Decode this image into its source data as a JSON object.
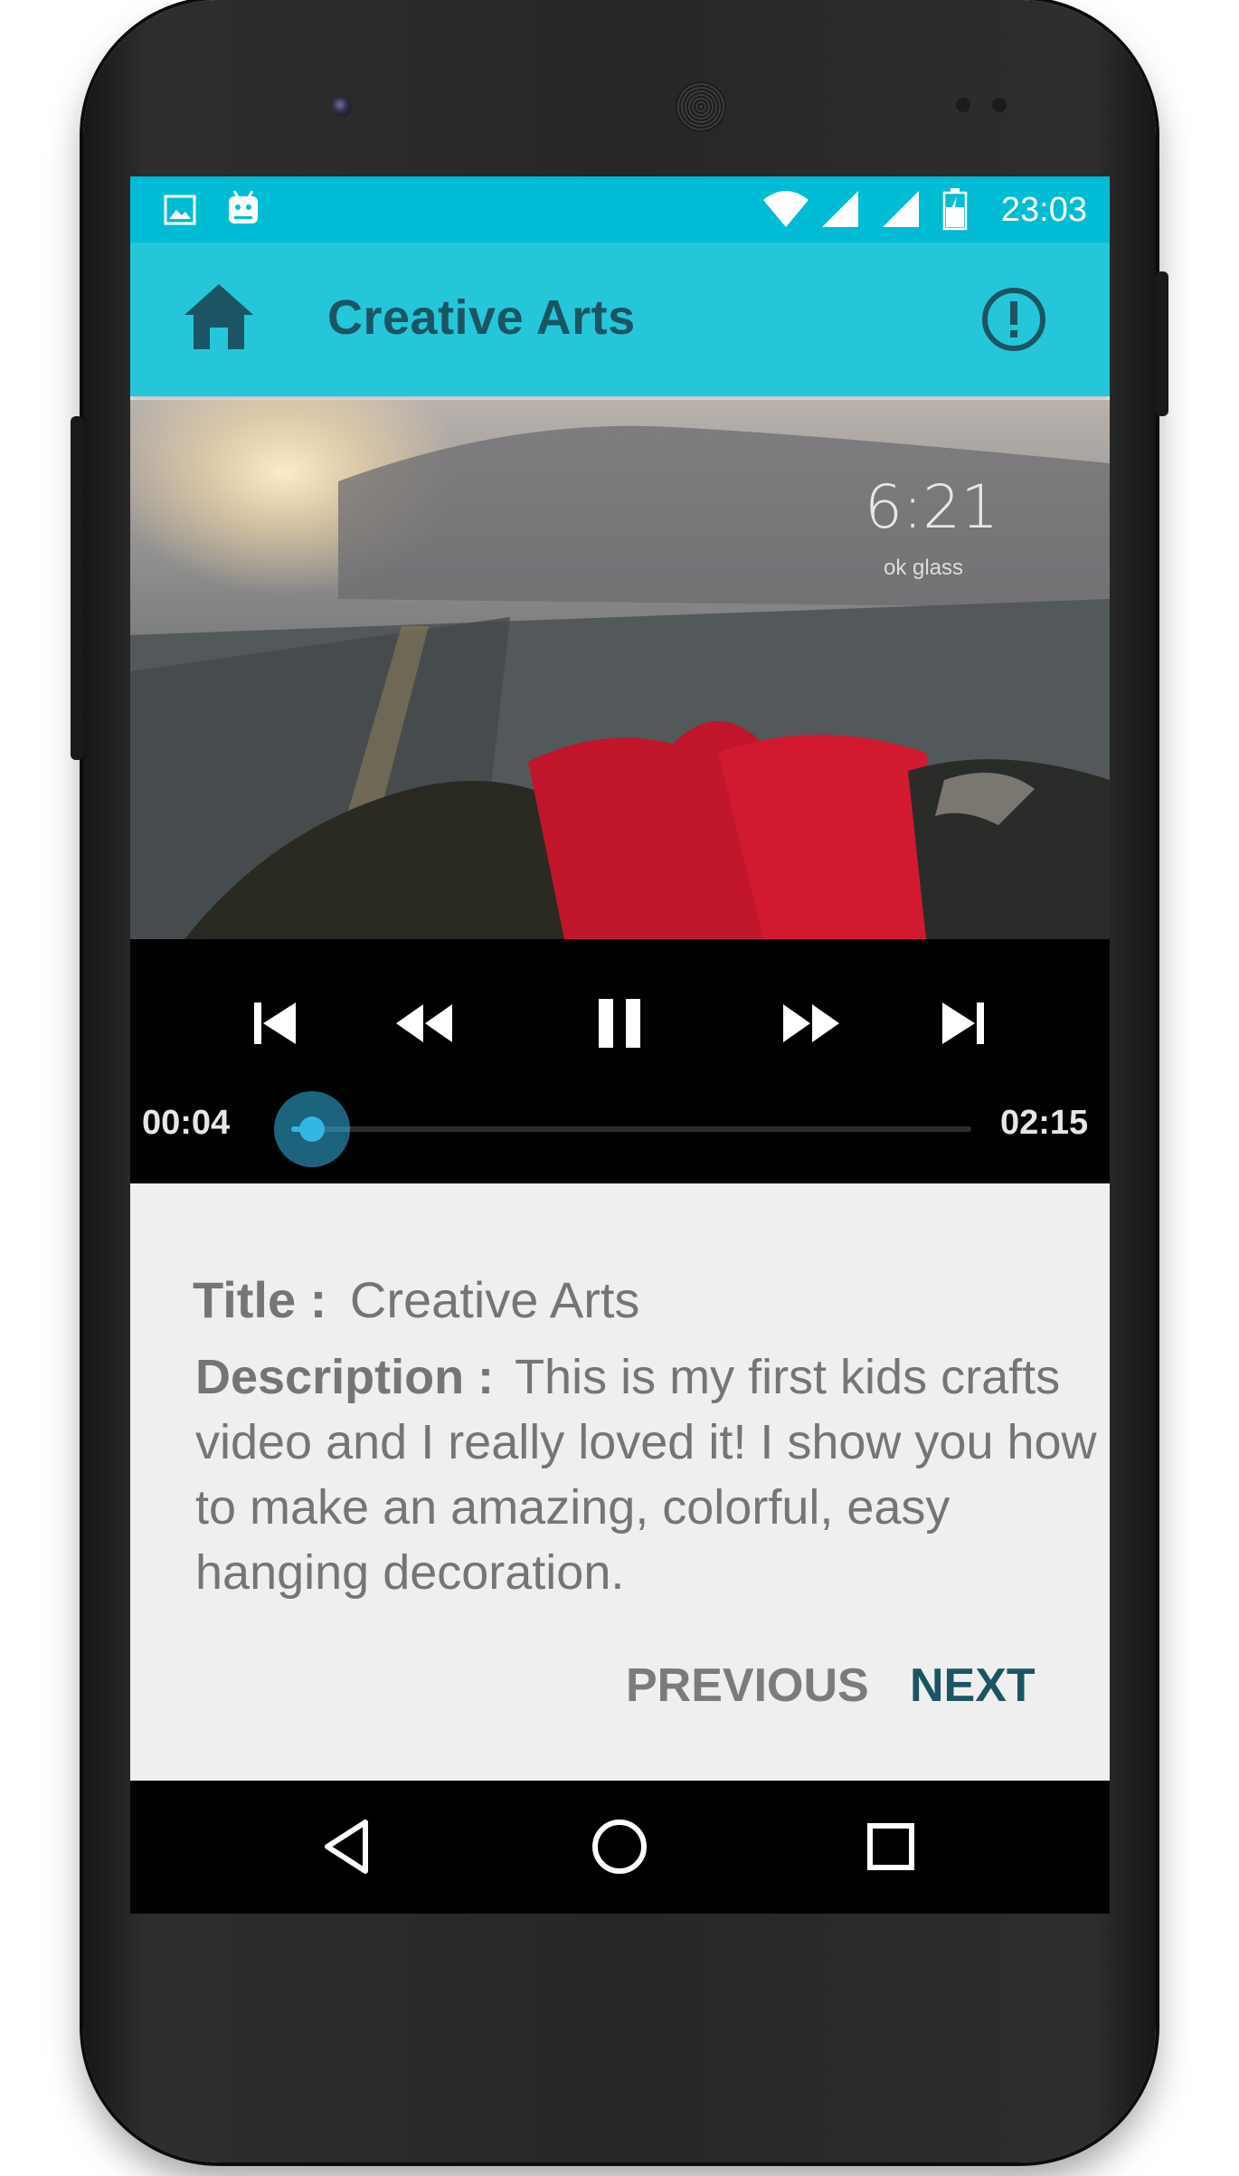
{
  "status_bar": {
    "time": "23:03",
    "icons": [
      "image-icon",
      "android-icon",
      "wifi-icon",
      "signal-icon",
      "signal-icon",
      "battery-icon"
    ]
  },
  "app_bar": {
    "title": "Creative Arts",
    "home_icon": "home-icon",
    "info_icon": "alert-circle-icon",
    "color": "#26c6da"
  },
  "video": {
    "overlay_time": "6:21",
    "overlay_caption": "ok glass"
  },
  "player": {
    "current_time": "00:04",
    "duration": "02:15",
    "progress_fraction": 0.03,
    "buttons": [
      "skip-previous-icon",
      "rewind-icon",
      "pause-icon",
      "fast-forward-icon",
      "skip-next-icon"
    ],
    "accent": "#33b5e5"
  },
  "details": {
    "title_label": "Title :",
    "title_value": "Creative Arts",
    "description_label": "Description :",
    "description_value": "This is my first kids crafts video and I really loved it! I show you how to make an amazing, colorful, easy hanging decoration."
  },
  "actions": {
    "previous_label": "PREVIOUS",
    "next_label": "NEXT"
  },
  "nav_bar": {
    "buttons": [
      "back-icon",
      "home-circle-icon",
      "recents-icon"
    ]
  }
}
